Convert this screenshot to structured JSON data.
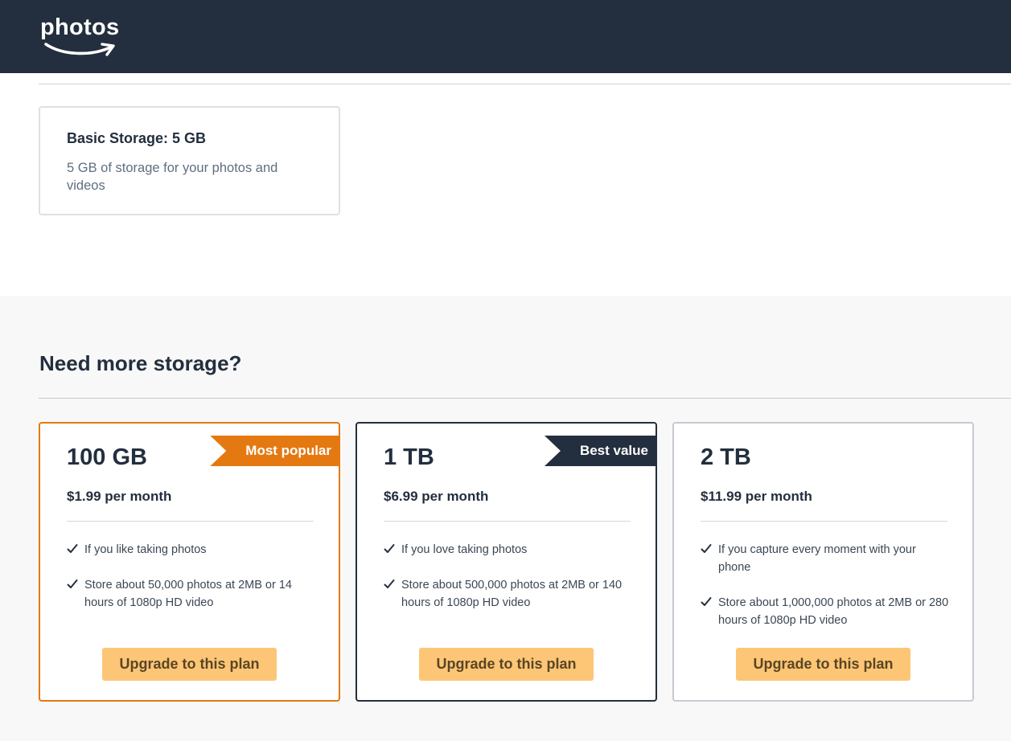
{
  "header": {
    "logo_text": "photos",
    "background_color": "#232f3e"
  },
  "current_plan": {
    "title": "Basic Storage: 5 GB",
    "description": "5 GB of storage for your photos and videos"
  },
  "upgrade_section": {
    "title": "Need more storage?",
    "plans": [
      {
        "size": "100 GB",
        "price": "$1.99 per month",
        "badge": "Most popular",
        "badge_color": "#e47911",
        "border_color": "#e47911",
        "features": [
          "If you like taking photos",
          "Store about 50,000 photos at 2MB or 14 hours of 1080p HD video"
        ],
        "button_label": "Upgrade to this plan"
      },
      {
        "size": "1 TB",
        "price": "$6.99 per month",
        "badge": "Best value",
        "badge_color": "#232f3e",
        "border_color": "#232f3e",
        "features": [
          "If you love taking photos",
          "Store about 500,000 photos at 2MB or 140 hours of 1080p HD video"
        ],
        "button_label": "Upgrade to this plan"
      },
      {
        "size": "2 TB",
        "price": "$11.99 per month",
        "border_color": "#c6cad2",
        "features": [
          "If you capture every moment with your phone",
          "Store about 1,000,000 photos at 2MB or 280 hours of 1080p HD video"
        ],
        "button_label": "Upgrade to this plan"
      }
    ]
  },
  "colors": {
    "accent_orange": "#e47911",
    "button_yellow": "#fdc676",
    "dark_navy": "#232f3e"
  }
}
